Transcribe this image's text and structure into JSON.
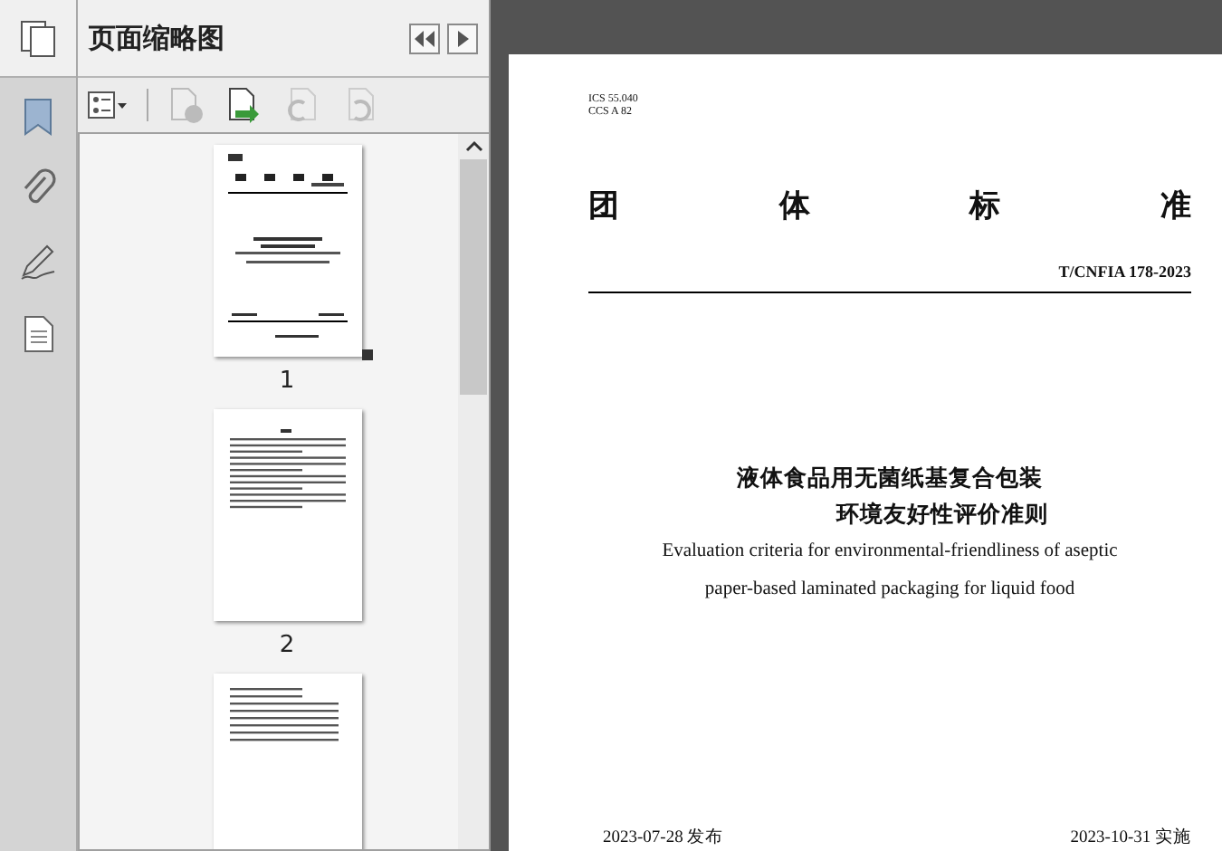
{
  "panel": {
    "title": "页面缩略图"
  },
  "thumbnails": [
    {
      "label": "1",
      "selected": true,
      "kind": "cover"
    },
    {
      "label": "2",
      "selected": false,
      "kind": "text"
    },
    {
      "kind": "contents",
      "selected": false
    }
  ],
  "document": {
    "codes": [
      "ICS 55.040",
      "CCS A 82"
    ],
    "heading": [
      "团",
      "体",
      "标",
      "准"
    ],
    "number": "T/CNFIA 178-2023",
    "title_zh": [
      "液体食品用无菌纸基复合包装",
      "环境友好性评价准则"
    ],
    "title_en": [
      "Evaluation criteria for environmental-friendliness of aseptic",
      "paper-based laminated packaging for liquid food"
    ],
    "issued": "2023-07-28 发布",
    "effective": "2023-10-31 实施"
  }
}
